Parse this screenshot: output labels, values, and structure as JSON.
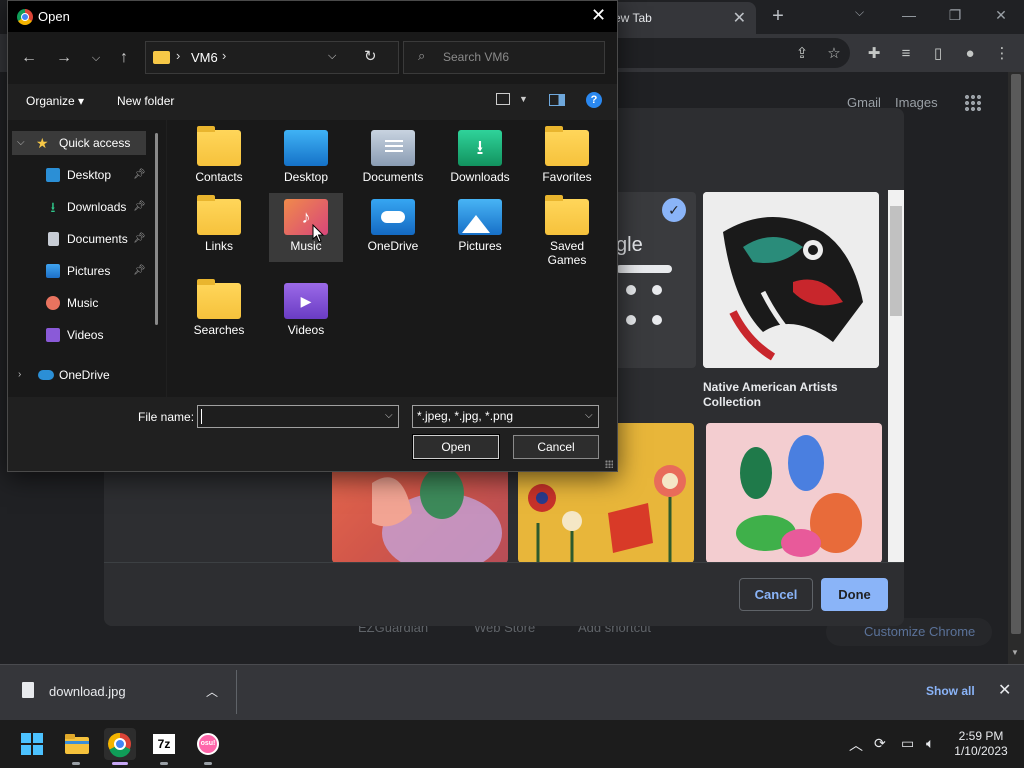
{
  "browser": {
    "tab_title": "ew Tab",
    "top_links": [
      "Gmail",
      "Images"
    ],
    "bottom_shortcuts": [
      "EZGuardian",
      "Web Store",
      "Add shortcut"
    ],
    "customize_label": "Customize Chrome"
  },
  "customize_modal": {
    "tile_caption": "Native American Artists Collection",
    "google_tile_text": "gle",
    "cancel_label": "Cancel",
    "done_label": "Done"
  },
  "dialog": {
    "title": "Open",
    "breadcrumb": "VM6",
    "search_placeholder": "Search VM6",
    "toolbar": {
      "organize": "Organize",
      "new_folder": "New folder"
    },
    "nav_items": [
      {
        "label": "Quick access",
        "icon": "star-icon"
      },
      {
        "label": "Desktop",
        "icon": "desktop-icon"
      },
      {
        "label": "Downloads",
        "icon": "download-icon"
      },
      {
        "label": "Documents",
        "icon": "documents-icon"
      },
      {
        "label": "Pictures",
        "icon": "pictures-icon"
      },
      {
        "label": "Music",
        "icon": "music-icon"
      },
      {
        "label": "Videos",
        "icon": "videos-icon"
      },
      {
        "label": "OneDrive",
        "icon": "onedrive-icon"
      }
    ],
    "files": [
      {
        "label": "Contacts",
        "icon": "folder-icon"
      },
      {
        "label": "Desktop",
        "icon": "desktop-folder-icon"
      },
      {
        "label": "Documents",
        "icon": "documents-folder-icon"
      },
      {
        "label": "Downloads",
        "icon": "downloads-folder-icon"
      },
      {
        "label": "Favorites",
        "icon": "folder-icon"
      },
      {
        "label": "Links",
        "icon": "folder-icon"
      },
      {
        "label": "Music",
        "icon": "music-folder-icon"
      },
      {
        "label": "OneDrive",
        "icon": "onedrive-folder-icon"
      },
      {
        "label": "Pictures",
        "icon": "pictures-folder-icon"
      },
      {
        "label": "Saved Games",
        "icon": "folder-icon"
      },
      {
        "label": "Searches",
        "icon": "folder-icon"
      },
      {
        "label": "Videos",
        "icon": "videos-folder-icon"
      }
    ],
    "filename_label": "File name:",
    "filename_value": "",
    "filetype_value": "*.jpeg, *.jpg, *.png",
    "open_label": "Open",
    "cancel_label": "Cancel"
  },
  "download_bar": {
    "file_name": "download.jpg",
    "show_all": "Show all"
  },
  "taskbar": {
    "time": "2:59 PM",
    "date": "1/10/2023",
    "apps": [
      "start-icon",
      "file-explorer-icon",
      "chrome-icon",
      "7zip-icon",
      "osu-icon"
    ]
  },
  "colors": {
    "accent": "#8ab4f8",
    "folder_yellow": "#f6c23c",
    "dialog_bg": "#191919"
  }
}
